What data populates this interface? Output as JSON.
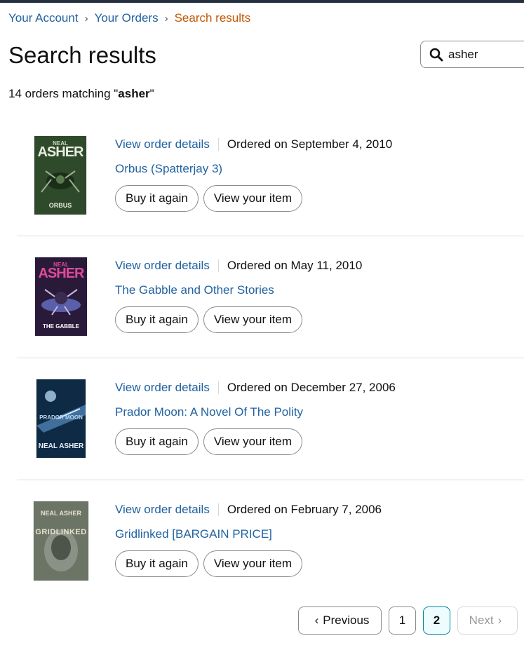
{
  "breadcrumb": {
    "items": [
      "Your Account",
      "Your Orders"
    ],
    "current": "Search results",
    "separator": "›"
  },
  "page_title": "Search results",
  "search": {
    "value": "asher",
    "icon": "search-icon"
  },
  "summary": {
    "prefix": "14 orders matching ",
    "quote_open": "\"",
    "term": "asher",
    "quote_close": "\""
  },
  "orders": [
    {
      "details_label": "View order details",
      "ordered_on": "Ordered on September 4, 2010",
      "title": "Orbus (Spatterjay 3)",
      "buy_again": "Buy it again",
      "view_item": "View your item",
      "cover": {
        "author_small": "NEAL",
        "author": "ASHER",
        "book": "ORBUS",
        "bg": "#2f4a2a",
        "accent": "#c9d7bf"
      }
    },
    {
      "details_label": "View order details",
      "ordered_on": "Ordered on May 11, 2010",
      "title": "The Gabble and Other Stories",
      "buy_again": "Buy it again",
      "view_item": "View your item",
      "cover": {
        "author_small": "NEAL",
        "author": "ASHER",
        "book": "THE GABBLE",
        "bg": "#2a1a3a",
        "accent": "#e04a9a"
      }
    },
    {
      "details_label": "View order details",
      "ordered_on": "Ordered on December 27, 2006",
      "title": "Prador Moon: A Novel Of The Polity",
      "buy_again": "Buy it again",
      "view_item": "View your item",
      "cover": {
        "author_small": "",
        "author": "NEAL ASHER",
        "book": "PRADOR MOON",
        "bg": "#0f2a44",
        "accent": "#b9d6f0"
      }
    },
    {
      "details_label": "View order details",
      "ordered_on": "Ordered on February 7, 2006",
      "title": "Gridlinked [BARGAIN PRICE]",
      "buy_again": "Buy it again",
      "view_item": "View your item",
      "cover": {
        "author_small": "",
        "author": "NEAL ASHER",
        "book": "GRIDLINKED",
        "bg": "#6c7466",
        "accent": "#e8e4d0"
      }
    }
  ],
  "pagination": {
    "previous": "Previous",
    "pages": [
      "1",
      "2"
    ],
    "current_page": "2",
    "next": "Next"
  },
  "colors": {
    "link": "#2162a1",
    "breadcrumb_current": "#c45500",
    "page_active_border": "#008296"
  }
}
